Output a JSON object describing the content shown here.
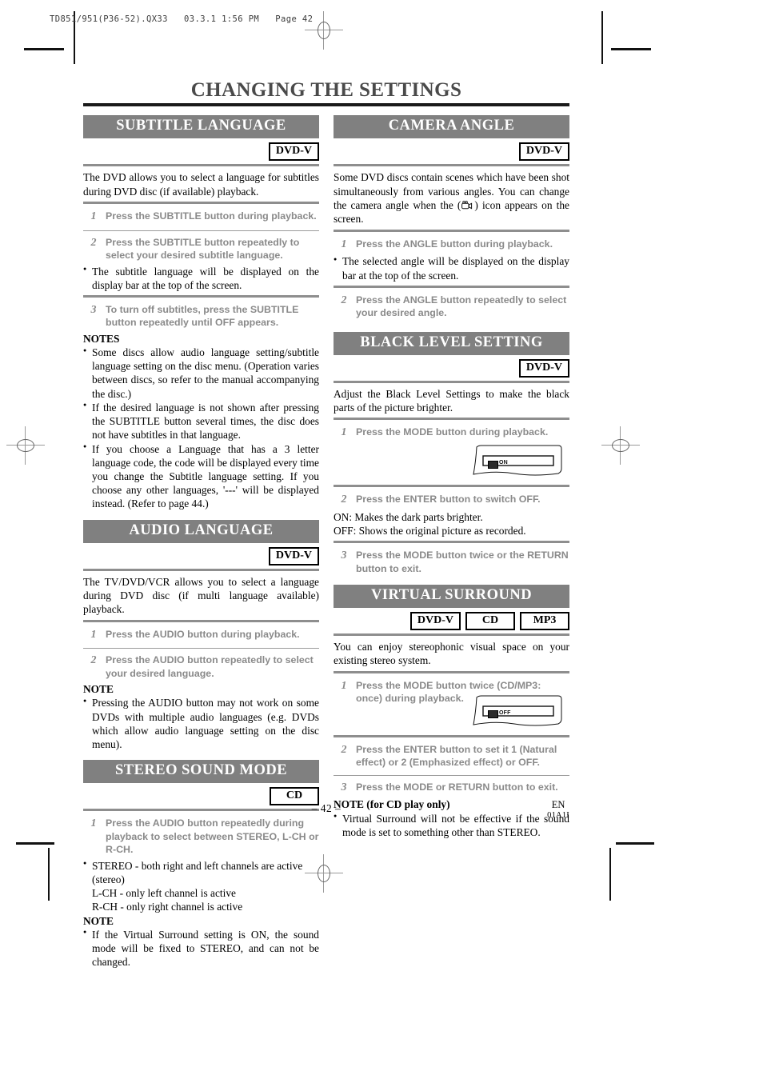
{
  "printer_slug": "TD851/951(P36-52).QX33   03.3.1 1:56 PM   Page 42",
  "doc_title": "CHANGING THE SETTINGS",
  "badges": {
    "dvd_v": "DVD-V",
    "cd": "CD",
    "mp3": "MP3"
  },
  "left_column": {
    "subtitle_language": {
      "heading": "SUBTITLE LANGUAGE",
      "badges": [
        "DVD-V"
      ],
      "intro": "The DVD allows you to select a language for subtitles during DVD disc (if available) playback.",
      "steps": [
        {
          "num": "1",
          "text": "Press the SUBTITLE button during playback."
        },
        {
          "num": "2",
          "text": "Press the SUBTITLE button repeatedly to select your desired subtitle language."
        },
        {
          "num": "3",
          "text": "To turn off subtitles, press the SUBTITLE button repeatedly until OFF appears."
        }
      ],
      "bullet_after_step2": "The subtitle language will be displayed on the display bar at the top of the screen.",
      "notes_heading": "NOTES",
      "notes": [
        "Some discs allow audio language setting/subtitle language setting on the disc menu. (Operation varies between discs, so refer to the manual accompanying the disc.)",
        "If the desired language is not shown after pressing the SUBTITLE button several times, the disc does not have subtitles in that language.",
        "If you choose a Language that has a 3 letter language code, the code will be displayed every time you change the Subtitle language setting. If you choose any other languages, '---' will be displayed instead. (Refer to page 44.)"
      ]
    },
    "audio_language": {
      "heading": "AUDIO LANGUAGE",
      "badges": [
        "DVD-V"
      ],
      "intro": "The TV/DVD/VCR allows you to select a language during DVD disc (if multi language available) playback.",
      "steps": [
        {
          "num": "1",
          "text": "Press the AUDIO button during playback."
        },
        {
          "num": "2",
          "text": "Press the AUDIO button repeatedly to select your desired language."
        }
      ],
      "notes_heading": "NOTE",
      "notes": [
        "Pressing the AUDIO button may not work on some DVDs with multiple audio languages (e.g. DVDs which allow audio language setting on the disc menu)."
      ]
    },
    "stereo_sound_mode": {
      "heading": "STEREO SOUND MODE",
      "badges": [
        "CD"
      ],
      "steps": [
        {
          "num": "1",
          "text": "Press the AUDIO button repeatedly during playback to select between STEREO, L-CH or R-CH."
        }
      ],
      "bullet_lines": [
        "STEREO - both right and left channels are active (stereo)",
        "L-CH - only left channel is active",
        "R-CH - only right channel is active"
      ],
      "notes_heading": "NOTE",
      "notes": [
        "If the Virtual Surround setting is ON, the sound mode will be fixed to STEREO, and can not be changed."
      ]
    }
  },
  "right_column": {
    "camera_angle": {
      "heading": "CAMERA ANGLE",
      "badges": [
        "DVD-V"
      ],
      "intro_part1": "Some DVD discs contain scenes which have been shot simultaneously from various angles. You can change the camera angle when the (",
      "intro_icon": "camcorder-icon",
      "intro_part2": ") icon appears on the screen.",
      "steps": [
        {
          "num": "1",
          "text": "Press the ANGLE button during playback."
        },
        {
          "num": "2",
          "text": "Press the ANGLE button repeatedly to select your desired angle."
        }
      ],
      "bullet_after_step1": "The selected angle will be displayed on the display bar at the top of the screen."
    },
    "black_level_setting": {
      "heading": "BLACK LEVEL SETTING",
      "badges": [
        "DVD-V"
      ],
      "intro": "Adjust the Black Level Settings to make the black parts of the picture brighter.",
      "steps": [
        {
          "num": "1",
          "text": "Press the MODE button during playback."
        },
        {
          "num": "2",
          "text": "Press the ENTER button to switch OFF."
        },
        {
          "num": "3",
          "text": "Press the MODE button twice or the RETURN button to exit."
        }
      ],
      "osd_display": "ON",
      "explanations": [
        "ON: Makes the dark parts brighter.",
        "OFF: Shows the original picture as recorded."
      ]
    },
    "virtual_surround": {
      "heading": "VIRTUAL SURROUND",
      "badges": [
        "DVD-V",
        "CD",
        "MP3"
      ],
      "intro": "You can enjoy stereophonic visual space on your existing stereo system.",
      "steps": [
        {
          "num": "1",
          "text": "Press the MODE button twice (CD/MP3: once) during playback."
        },
        {
          "num": "2",
          "text": "Press the ENTER button to set it 1 (Natural effect) or 2 (Emphasized effect) or OFF."
        },
        {
          "num": "3",
          "text": "Press the MODE or RETURN button to exit."
        }
      ],
      "osd_display": "OFF",
      "notes_heading": "NOTE (for CD play only)",
      "notes": [
        "Virtual Surround will not be effective if the sound mode is set to something other than STEREO."
      ]
    }
  },
  "footer": {
    "page_number": "– 42 –",
    "region": "EN",
    "code": "01A1I"
  },
  "colors": {
    "section_bar": "#808080",
    "title_text": "#4a4a4a",
    "step_text": "#8a8a8a",
    "rule": "#8e8e8e"
  }
}
